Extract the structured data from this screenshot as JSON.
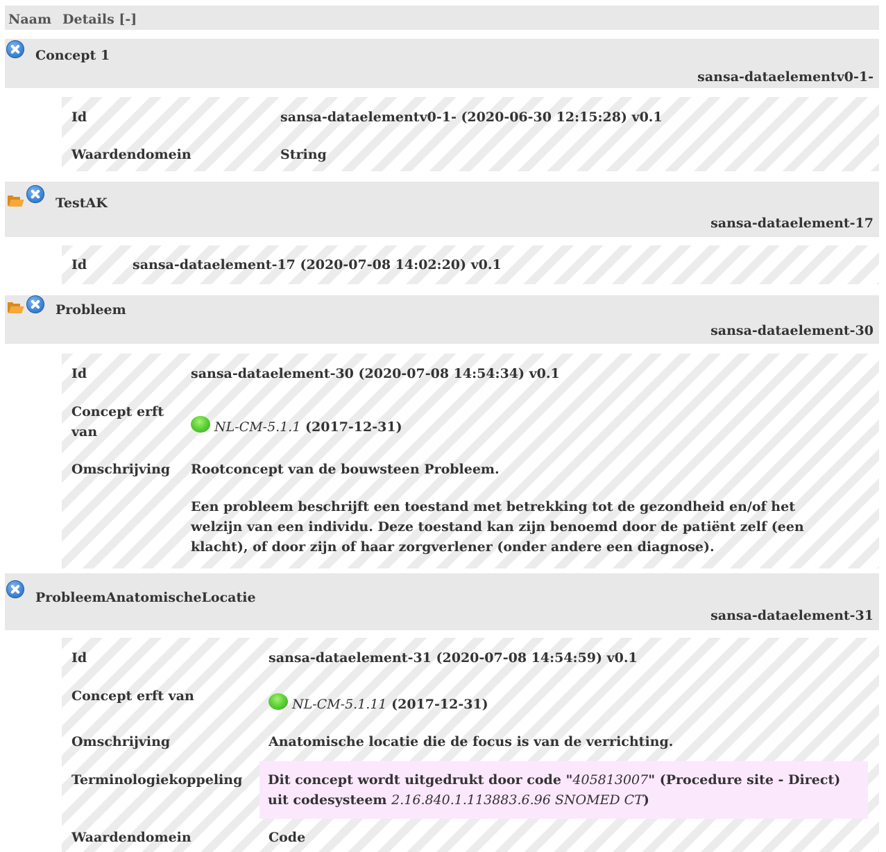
{
  "header": {
    "col_name": "Naam",
    "col_details": "Details [-]"
  },
  "concepts": [
    {
      "name": "Concept 1",
      "id": "sansa-dataelementv0-1-",
      "rows": [
        {
          "label": "Id",
          "value": "sansa-dataelementv0-1- (2020-06-30 12:15:28) v0.1"
        },
        {
          "label": "Waardendomein",
          "value": "String"
        }
      ]
    },
    {
      "name": "TestAK",
      "id": "sansa-dataelement-17",
      "rows": [
        {
          "label": "Id",
          "value": "sansa-dataelement-17 (2020-07-08 14:02:20) v0.1"
        }
      ]
    },
    {
      "name": "Probleem",
      "id": "sansa-dataelement-30",
      "rows": [
        {
          "label": "Id",
          "value": "sansa-dataelement-30 (2020-07-08 14:54:34) v0.1"
        },
        {
          "label": "Concept erft van",
          "inherit_code": "NL-CM-5.1.1",
          "inherit_date": "(2017-12-31)"
        },
        {
          "label": "Omschrijving",
          "value": "Rootconcept van de bouwsteen Probleem.",
          "value_extra": "Een probleem beschrijft een toestand met betrekking tot de gezondheid en/of het welzijn van een individu. Deze toestand kan zijn benoemd door de patiënt zelf (een klacht), of door zijn of haar zorgverlener (onder andere een diagnose)."
        }
      ]
    },
    {
      "name": "ProbleemAnatomischeLocatie",
      "id": "sansa-dataelement-31",
      "rows": [
        {
          "label": "Id",
          "value": "sansa-dataelement-31 (2020-07-08 14:54:59) v0.1"
        },
        {
          "label": "Concept erft van",
          "inherit_code": "NL-CM-5.1.11",
          "inherit_date": "(2017-12-31)"
        },
        {
          "label": "Omschrijving",
          "value": "Anatomische locatie die de focus is van de verrichting."
        },
        {
          "label": "Terminologiekoppeling",
          "term_prefix": "Dit concept wordt uitgedrukt door code \"",
          "term_code": "405813007",
          "term_mid": "\" (Procedure site - Direct) uit codesysteem ",
          "term_system": "2.16.840.1.113883.6.96 SNOMED CT",
          "term_suffix": ")"
        },
        {
          "label": "Waardendomein",
          "value": "Code"
        }
      ]
    }
  ]
}
